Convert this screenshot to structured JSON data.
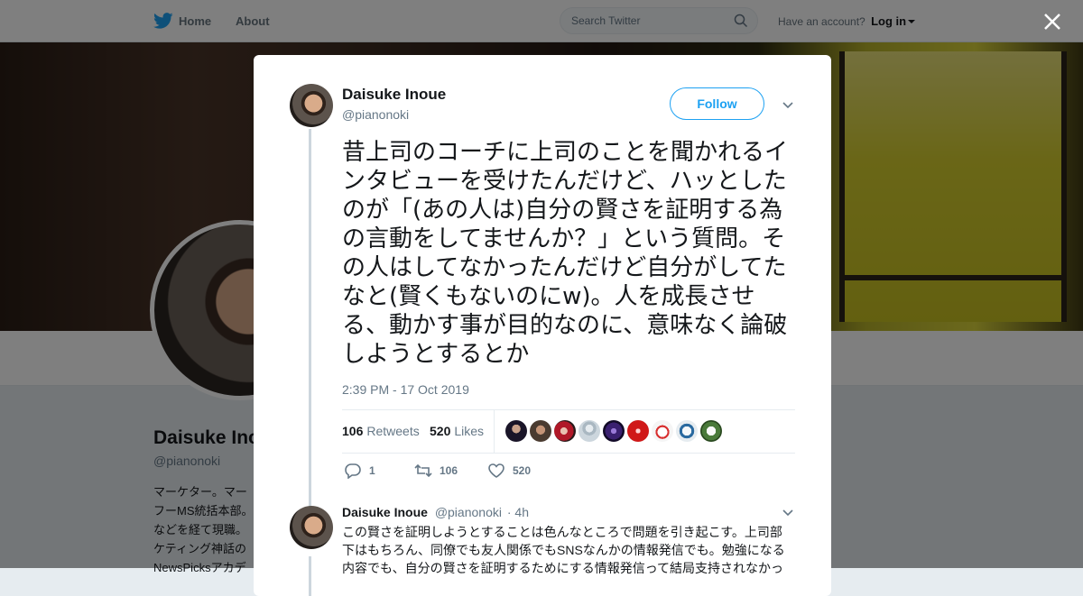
{
  "nav": {
    "home_label": "Home",
    "about_label": "About",
    "search_placeholder": "Search Twitter",
    "account_prompt": "Have an account?",
    "login_label": "Log in"
  },
  "profile": {
    "name": "Daisuke Inoue",
    "handle": "@pianonoki",
    "bio_lines": [
      "マーケター。マー",
      "フーMS統括本部。",
      "などを経て現職。",
      "ケティング神話の",
      "NewsPicksアカデ"
    ]
  },
  "tweet": {
    "author_name": "Daisuke Inoue",
    "author_handle": "@pianonoki",
    "follow_label": "Follow",
    "text": "昔上司のコーチに上司のことを聞かれるインタビューを受けたんだけど、ハッとしたのが「(あの人は)自分の賢さを証明する為の言動をしてませんか？」という質問。その人はしてなかったんだけど自分がしてたなと(賢くもないのにw)。人を成長させる、動かす事が目的なのに、意味なく論破しようとするとか",
    "timestamp": "2:39 PM - 17 Oct 2019",
    "retweets_count": "106",
    "retweets_label": "Retweets",
    "likes_count": "520",
    "likes_label": "Likes",
    "reply_count": "1",
    "retweet_action_count": "106",
    "like_action_count": "520"
  },
  "reply": {
    "author_name": "Daisuke Inoue",
    "author_handle": "@pianonoki",
    "time": "· 4h",
    "text": "この賢さを証明しようとすることは色んなところで問題を引き起こす。上司部下はもちろん、同僚でも友人関係でもSNSなんかの情報発信でも。勉強になる内容でも、自分の賢さを証明するためにする情報発信って結局支持されなかっ"
  },
  "colors": {
    "accent": "#1da1f2",
    "text_primary": "#14171a",
    "text_secondary": "#657786",
    "thread_line": "#ccd6dd"
  },
  "icons": [
    "twitter-bird-icon",
    "search-icon",
    "close-icon",
    "chevron-down-icon",
    "reply-icon",
    "retweet-icon",
    "like-icon"
  ]
}
